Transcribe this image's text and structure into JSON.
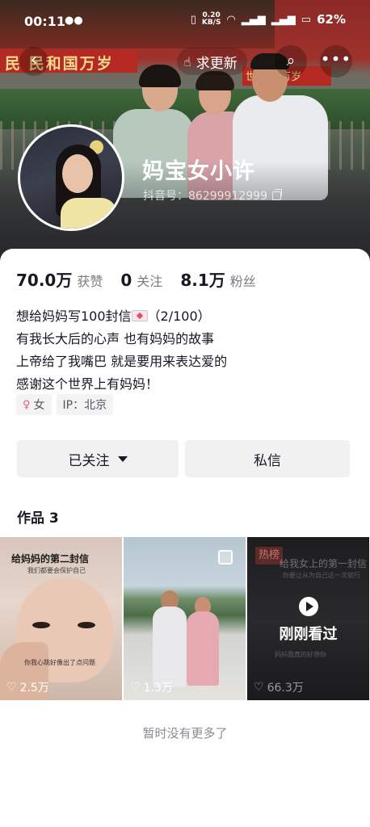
{
  "status_bar": {
    "time": "00:11",
    "net_speed": "0.20",
    "net_unit": "KB/S",
    "battery": "62%"
  },
  "cover": {
    "banner_left": "民 民和国万岁",
    "banner_right": "世界人 万岁"
  },
  "nav": {
    "back_icon": "chevron-left-icon",
    "request_update": "求更新",
    "search_icon": "search-icon",
    "more_icon": "more-icon"
  },
  "profile": {
    "name": "妈宝女小许",
    "douyin_id": "抖音号：86299912999"
  },
  "stats": [
    {
      "value": "70.0万",
      "label": "获赞"
    },
    {
      "value": "0",
      "label": "关注"
    },
    {
      "value": "8.1万",
      "label": "粉丝"
    }
  ],
  "bio": {
    "line1_prefix": "想给妈妈写100封信",
    "line1_suffix": "（2/100）",
    "line2": "有我长大后的心声 也有妈妈的故事",
    "line3": "上帝给了我嘴巴 就是要用来表达爱的",
    "line4": "感谢这个世界上有妈妈！"
  },
  "tags": {
    "gender": "女",
    "ip": "IP：北京"
  },
  "buttons": {
    "follow": "已关注",
    "message": "私信"
  },
  "works": {
    "title": "作品 3",
    "items": [
      {
        "caption": "给妈妈的第二封信",
        "sub": "我们都要会保护自己",
        "bottom_text": "你我心跳好像出了点问题",
        "likes": "2.5万"
      },
      {
        "likes": "1.3万"
      },
      {
        "badge": "热榜",
        "caption": "给我女上的第一封信",
        "sub": "你要让从为自己这一次就行",
        "bottom_text": "妈妈我真的好想你",
        "overlay": "刚刚看过",
        "likes": "66.3万"
      }
    ]
  },
  "footer": {
    "no_more": "暂时没有更多了"
  }
}
